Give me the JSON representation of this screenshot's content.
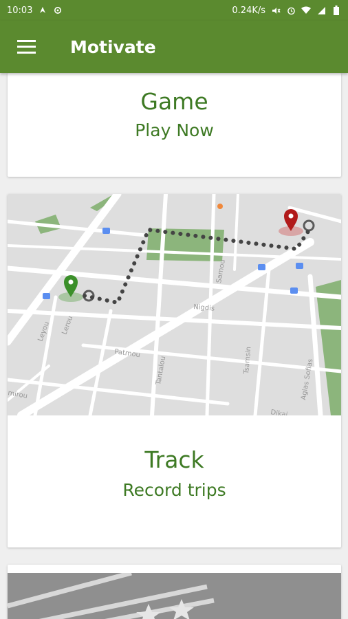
{
  "status_bar": {
    "time": "10:03",
    "network_speed": "0.24K/s",
    "icons": [
      "navigation-icon",
      "sync-icon",
      "mute-icon",
      "alarm-icon",
      "wifi-icon",
      "signal-icon",
      "battery-icon"
    ]
  },
  "app_bar": {
    "title": "Motivate",
    "menu_icon": "hamburger-menu-icon"
  },
  "cards": [
    {
      "title": "Game",
      "subtitle": "Play Now"
    },
    {
      "title": "Track",
      "subtitle": "Record trips",
      "image": "map-route-illustration"
    },
    {
      "title": "",
      "subtitle": "",
      "image": "road-stars-illustration"
    }
  ],
  "map_labels": [
    "Leyou",
    "Lerou",
    "Patmou",
    "Tantalou",
    "Nigdis",
    "Tsamsin",
    "Samou",
    "Agias Sofias",
    "Dikai"
  ],
  "colors": {
    "primary": "#5b8a2f",
    "accent_text": "#3e7a24",
    "start_pin": "#3b8f2a",
    "end_pin": "#b11a1a",
    "route": "#444444"
  }
}
